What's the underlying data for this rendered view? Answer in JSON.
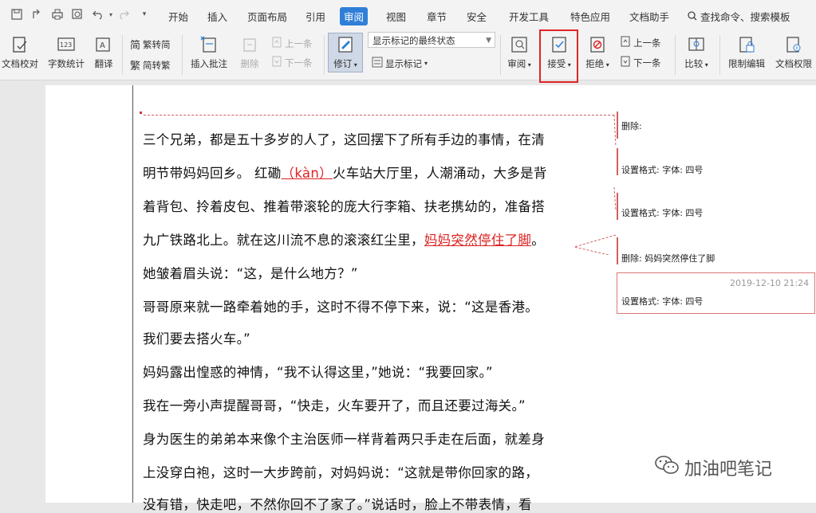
{
  "quick_access": {
    "save_icon": "save-icon",
    "share_icon": "share-icon",
    "print_icon": "print-icon",
    "preview_icon": "print-preview-icon",
    "undo_icon": "undo-icon",
    "redo_icon": "redo-icon",
    "more_icon": "chevron-down-icon"
  },
  "menu": {
    "tabs": [
      "开始",
      "插入",
      "页面布局",
      "引用",
      "审阅",
      "视图",
      "章节",
      "安全",
      "开发工具",
      "特色应用",
      "文档助手"
    ],
    "active_tab": "审阅",
    "search_label": "查找命令、搜索模板"
  },
  "ribbon": {
    "proofread": "文档校对",
    "word_count": "字数统计",
    "translate": "翻译",
    "trad_to_simp": "繁转简",
    "simp_to_trad": "简转繁",
    "insert_comment": "插入批注",
    "delete": "删除",
    "prev_comment": "上一条",
    "next_comment": "下一条",
    "track_changes": "修订",
    "display_mode": "显示标记的最终状态",
    "show_markup": "显示标记",
    "review": "审阅",
    "accept": "接受",
    "reject": "拒绝",
    "prev_change": "上一条",
    "next_change": "下一条",
    "compare": "比较",
    "restrict_editing": "限制编辑",
    "doc_permissions": "文档权限"
  },
  "document": {
    "lines": [
      {
        "text": "三个兄弟，都是五十多岁的人了，这回摆下了所有手边的事情，在清"
      },
      {
        "text_a": "明节带妈妈回乡。 红磡",
        "insert": "（kàn）",
        "text_b": "火车站大厅里，人潮涌动，大多是背"
      },
      {
        "text": "着背包、拎着皮包、推着带滚轮的庞大行李箱、扶老携幼的，准备搭"
      },
      {
        "text_a": "九广铁路北上。就在这川流不息的滚滚红尘里，",
        "deleted": "妈妈突然停住了脚",
        "text_b": "。"
      },
      {
        "text": "她皱着眉头说：“这，是什么地方？”"
      },
      {
        "text": "哥哥原来就一路牵着她的手，这时不得不停下来，说：“这是香港。"
      },
      {
        "text": "我们要去搭火车。”"
      },
      {
        "text": "妈妈露出惶惑的神情，“我不认得这里，”她说：“我要回家。”"
      },
      {
        "text": "我在一旁小声提醒哥哥，“快走，火车要开了，而且还要过海关。”"
      },
      {
        "text": "身为医生的弟弟本来像个主治医师一样背着两只手走在后面，就差身"
      },
      {
        "text": "上没穿白袍，这时一大步跨前，对妈妈说：“这就是带你回家的路，"
      },
      {
        "text": "没有错，快走吧，不然你回不了家了。”说话时，脸上不带表情，看"
      }
    ]
  },
  "comments": [
    {
      "text": "删除:"
    },
    {
      "text": "设置格式: 字体: 四号"
    },
    {
      "text": "设置格式: 字体: 四号"
    },
    {
      "text": "删除: 妈妈突然停住了脚"
    },
    {
      "text": "设置格式: 字体: 四号",
      "timestamp": "2019-12-10 21:24"
    }
  ],
  "watermark": "加油吧笔记",
  "colors": {
    "accent": "#2f7fd8",
    "revision": "#d22222",
    "highlight_box": "#e02424"
  }
}
